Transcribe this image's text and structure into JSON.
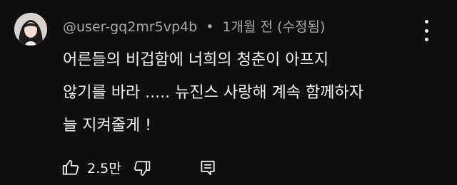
{
  "comment": {
    "author": "@user-gq2mr5vp4b",
    "separator": "•",
    "timestamp": "1개월 전",
    "edited_label": "(수정됨)",
    "lines": [
      "어른들의 비겁함에 너희의 청춘이 아프지",
      "않기를 바라 ..... 뉴진스 사랑해 계속 함께하자",
      "늘 지켜줄게 !"
    ],
    "like_count": "2.5만"
  },
  "icons": {
    "avatar": "avatar-image",
    "more": "more-vert-icon",
    "like": "thumb-up-icon",
    "dislike": "thumb-down-icon",
    "reply": "reply-comment-icon"
  },
  "colors": {
    "background": "#0f0f0f",
    "text_primary": "#f1f1f1",
    "text_secondary": "#aaaaaa"
  }
}
